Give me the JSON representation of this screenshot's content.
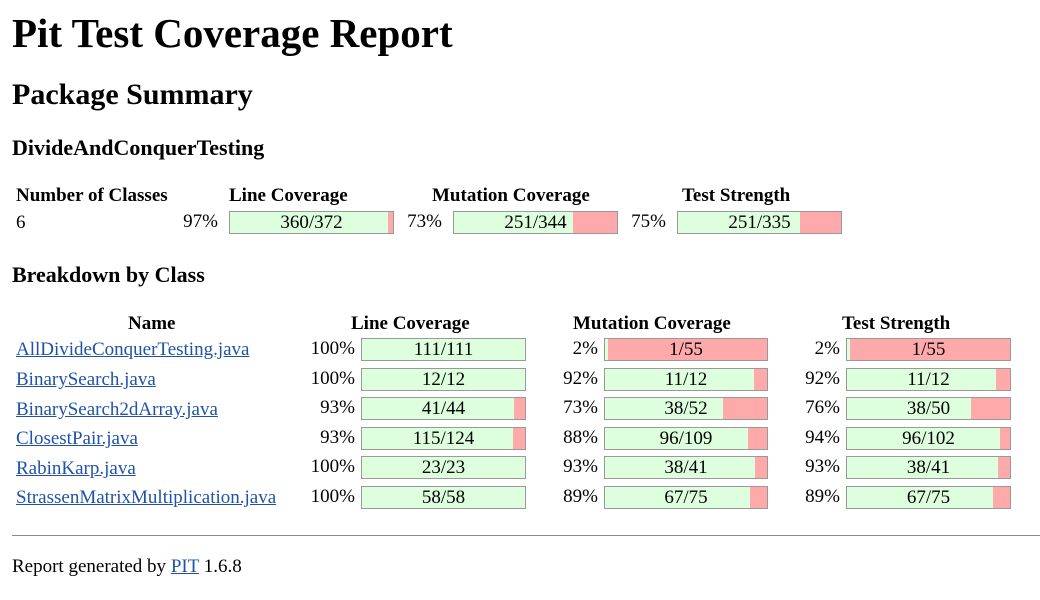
{
  "title": "Pit Test Coverage Report",
  "package_summary_heading": "Package Summary",
  "package_name": "DivideAndConquerTesting",
  "summary": {
    "headers": {
      "classes": "Number of Classes",
      "line": "Line Coverage",
      "mutation": "Mutation Coverage",
      "strength": "Test Strength"
    },
    "classes": "6",
    "line": {
      "pct": "97%",
      "label": "360/372",
      "fraction": 0.9677
    },
    "mutation": {
      "pct": "73%",
      "label": "251/344",
      "fraction": 0.7297
    },
    "strength": {
      "pct": "75%",
      "label": "251/335",
      "fraction": 0.7493
    }
  },
  "breakdown_heading": "Breakdown by Class",
  "breakdown_headers": {
    "name": "Name",
    "line": "Line Coverage",
    "mutation": "Mutation Coverage",
    "strength": "Test Strength"
  },
  "classes": [
    {
      "name": "AllDivideConquerTesting.java",
      "line": {
        "pct": "100%",
        "label": "111/111",
        "fraction": 1.0
      },
      "mutation": {
        "pct": "2%",
        "label": "1/55",
        "fraction": 0.0182
      },
      "strength": {
        "pct": "2%",
        "label": "1/55",
        "fraction": 0.0182
      }
    },
    {
      "name": "BinarySearch.java",
      "line": {
        "pct": "100%",
        "label": "12/12",
        "fraction": 1.0
      },
      "mutation": {
        "pct": "92%",
        "label": "11/12",
        "fraction": 0.9167
      },
      "strength": {
        "pct": "92%",
        "label": "11/12",
        "fraction": 0.9167
      }
    },
    {
      "name": "BinarySearch2dArray.java",
      "line": {
        "pct": "93%",
        "label": "41/44",
        "fraction": 0.9318
      },
      "mutation": {
        "pct": "73%",
        "label": "38/52",
        "fraction": 0.7308
      },
      "strength": {
        "pct": "76%",
        "label": "38/50",
        "fraction": 0.76
      }
    },
    {
      "name": "ClosestPair.java",
      "line": {
        "pct": "93%",
        "label": "115/124",
        "fraction": 0.9274
      },
      "mutation": {
        "pct": "88%",
        "label": "96/109",
        "fraction": 0.8807
      },
      "strength": {
        "pct": "94%",
        "label": "96/102",
        "fraction": 0.9412
      }
    },
    {
      "name": "RabinKarp.java",
      "line": {
        "pct": "100%",
        "label": "23/23",
        "fraction": 1.0
      },
      "mutation": {
        "pct": "93%",
        "label": "38/41",
        "fraction": 0.9268
      },
      "strength": {
        "pct": "93%",
        "label": "38/41",
        "fraction": 0.9268
      }
    },
    {
      "name": "StrassenMatrixMultiplication.java",
      "line": {
        "pct": "100%",
        "label": "58/58",
        "fraction": 1.0
      },
      "mutation": {
        "pct": "89%",
        "label": "67/75",
        "fraction": 0.8933
      },
      "strength": {
        "pct": "89%",
        "label": "67/75",
        "fraction": 0.8933
      }
    }
  ],
  "footer": {
    "prefix": "Report generated by",
    "link": "PIT",
    "version": "1.6.8"
  },
  "colors": {
    "covered": "#ddffdd",
    "uncovered": "#ffaaaa",
    "link": "#1f52a8"
  }
}
